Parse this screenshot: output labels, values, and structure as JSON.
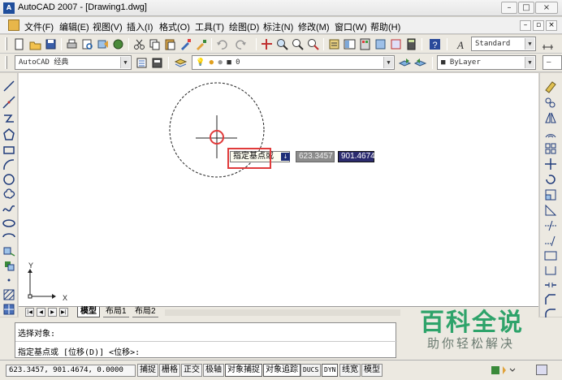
{
  "window": {
    "title": "AutoCAD 2007 - [Drawing1.dwg]",
    "app_icon": "A",
    "controls": {
      "minimize": "–",
      "maximize": "□",
      "close": "×"
    }
  },
  "menu": {
    "items": [
      "文件(F)",
      "编辑(E)",
      "视图(V)",
      "插入(I)",
      "格式(O)",
      "工具(T)",
      "绘图(D)",
      "标注(N)",
      "修改(M)",
      "窗口(W)",
      "帮助(H)"
    ],
    "mdi_controls": {
      "minimize": "–",
      "restore": "▫",
      "close": "×"
    }
  },
  "toolbar1": {
    "text_style": "Standard"
  },
  "toolbar2": {
    "workspace": "AutoCAD 经典",
    "layer": "0",
    "linetype": "ByLayer"
  },
  "drawing": {
    "ucs": {
      "x_label": "X",
      "y_label": "Y"
    }
  },
  "dynamic_input": {
    "prompt": "指定基点或",
    "x_value": "623.3457",
    "y_value": "901.4674",
    "arrow": "↓"
  },
  "layout_tabs": {
    "nav": [
      "|◀",
      "◀",
      "▶",
      "▶|"
    ],
    "tabs": [
      "模型",
      "布局1",
      "布局2"
    ]
  },
  "command": {
    "line1": "选择对象:",
    "line2": "指定基点或 [位移(D)] <位移>:"
  },
  "watermark": {
    "title": "百科全说",
    "subtitle": "助你轻松解决"
  },
  "status": {
    "coordinates": "623.3457, 901.4674, 0.0000",
    "buttons": [
      "捕捉",
      "栅格",
      "正交",
      "极轴",
      "对象捕捉",
      "对象追踪",
      "DUCS",
      "DYN",
      "线宽",
      "模型"
    ]
  },
  "colors": {
    "highlight": "#e03b3b",
    "watermark_green": "#2ea36a",
    "dyn_blue": "#2b2b6e"
  }
}
